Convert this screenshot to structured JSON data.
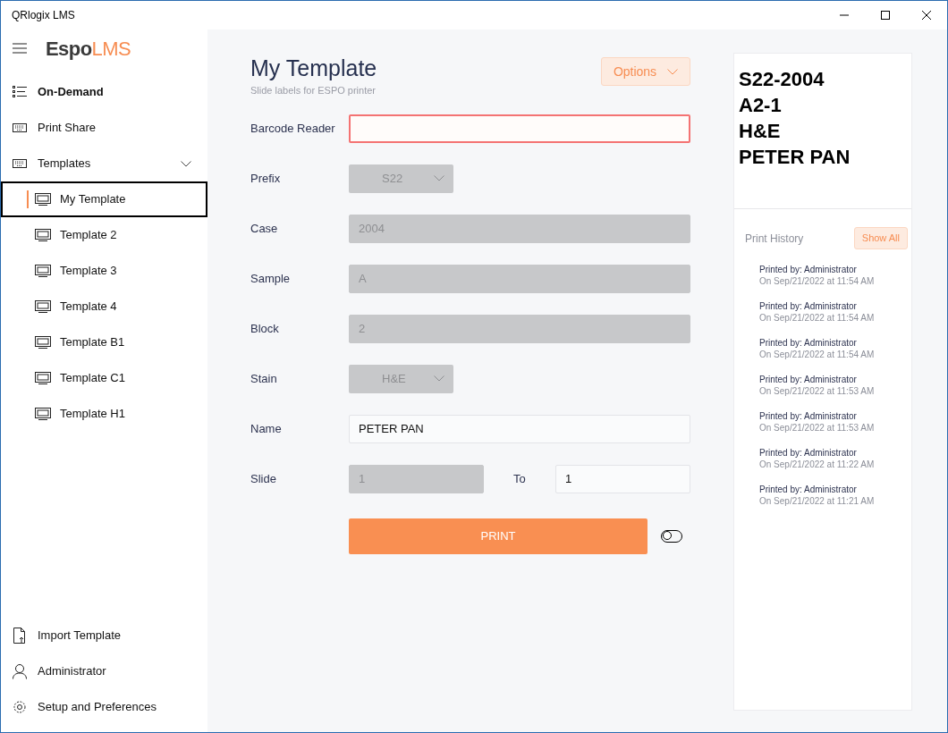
{
  "window": {
    "title": "QRlogix LMS"
  },
  "logo": {
    "part_1": "Espo",
    "part_2": "LMS"
  },
  "nav": [
    {
      "label": "On-Demand",
      "kind": "list",
      "selected": true
    },
    {
      "label": "Print Share",
      "kind": "keyboard",
      "selected": false
    },
    {
      "label": "Templates",
      "kind": "keyboard",
      "selected": false,
      "expanded": true,
      "children": [
        {
          "label": "My Template",
          "selected": true
        },
        {
          "label": "Template 2",
          "selected": false
        },
        {
          "label": "Template 3",
          "selected": false
        },
        {
          "label": "Template 4",
          "selected": false
        },
        {
          "label": "Template B1",
          "selected": false
        },
        {
          "label": "Template C1",
          "selected": false
        },
        {
          "label": "Template H1",
          "selected": false
        }
      ]
    }
  ],
  "bottom_nav": [
    {
      "label": "Import Template",
      "kind": "import"
    },
    {
      "label": "Administrator",
      "kind": "user"
    },
    {
      "label": "Setup and Preferences",
      "kind": "gear"
    }
  ],
  "page": {
    "title": "My Template",
    "subtitle": "Slide labels for ESPO printer",
    "options_button": "Options"
  },
  "fields": [
    {
      "label": "Barcode Reader",
      "kind": "input",
      "disabled": false,
      "invalid": true
    },
    {
      "label": "Prefix",
      "kind": "select",
      "value": "S22",
      "disabled": true
    },
    {
      "label": "Case",
      "kind": "input",
      "value": "2004",
      "disabled": true
    },
    {
      "label": "Sample",
      "kind": "input",
      "value": "A",
      "disabled": true
    },
    {
      "label": "Block",
      "kind": "input",
      "value": "2",
      "disabled": true
    },
    {
      "label": "Stain",
      "kind": "select",
      "value": "H&E",
      "disabled": true
    },
    {
      "label": "Name",
      "kind": "input",
      "value": "PETER PAN",
      "disabled": false
    },
    {
      "label": "Slide",
      "kind": "range",
      "value": "1",
      "disabled": true,
      "to_label": "To",
      "to_value": "1"
    }
  ],
  "print_button": "PRINT",
  "toggle": {
    "on": false
  },
  "preview": {
    "lines": [
      "S22-2004",
      "A2-1",
      "H&E",
      "PETER PAN"
    ]
  },
  "history": {
    "title": "Print History",
    "show_all": "Show All",
    "entries": [
      {
        "by": "Printed by: Administrator",
        "when": "On Sep/21/2022 at 11:54 AM"
      },
      {
        "by": "Printed by: Administrator",
        "when": "On Sep/21/2022 at 11:54 AM"
      },
      {
        "by": "Printed by: Administrator",
        "when": "On Sep/21/2022 at 11:54 AM"
      },
      {
        "by": "Printed by: Administrator",
        "when": "On Sep/21/2022 at 11:53 AM"
      },
      {
        "by": "Printed by: Administrator",
        "when": "On Sep/21/2022 at 11:53 AM"
      },
      {
        "by": "Printed by: Administrator",
        "when": "On Sep/21/2022 at 11:22 AM"
      },
      {
        "by": "Printed by: Administrator",
        "when": "On Sep/21/2022 at 11:21 AM"
      }
    ]
  }
}
